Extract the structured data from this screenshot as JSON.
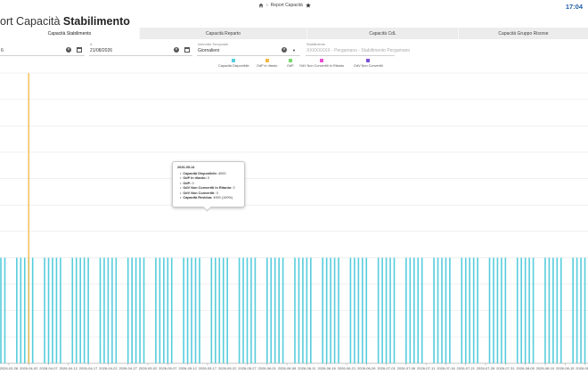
{
  "header": {
    "breadcrumb_separator": "›",
    "breadcrumb_current": "Report Capacità",
    "clock": "17:04"
  },
  "title": {
    "light": "ort Capacità",
    "bold": "Stabilimento"
  },
  "tabs": [
    {
      "label": "Capacità Stabilimento",
      "active": true
    },
    {
      "label": "Capacità Reparto",
      "active": false
    },
    {
      "label": "Capacità CdL",
      "active": false
    },
    {
      "label": "Capacità Gruppo Risorse",
      "active": false
    }
  ],
  "filters": {
    "from_value": "6",
    "to_label": "A",
    "to_value": "21/08/2026",
    "interval_label": "Intervallo Temporale",
    "interval_value": "Giornaliero",
    "plant_label": "Stabilimento",
    "plant_value": "XXXXXXXX - Pergamano - Stabilimento Pergamano"
  },
  "colors": {
    "capacity": "#56cddc",
    "odp_late": "#f5b940",
    "odp": "#77d96e",
    "odv_not_converted_late": "#e94fd2",
    "odv_not_converted": "#7b4fd9",
    "grid": "#e6e6e6",
    "axis": "#999999"
  },
  "chart_data": {
    "type": "bar",
    "legend": [
      "Capacità Disponibile",
      "OdP in ritardo",
      "OdP",
      "OdV Non Convertiti In Ritardo",
      "OdV Non Convertiti"
    ],
    "legend_position": "top-right",
    "grid": true,
    "series_name": "Capacità Disponibile",
    "bar_value": 4000,
    "ylim": [
      0,
      11000
    ],
    "x_start": "2026-03-26",
    "x_end": "2026-08-21",
    "weekends_excluded": true,
    "today_marker": "2026-04-02",
    "tick_labels": [
      "2026-03-28",
      "2026-04-02",
      "2026-04-07",
      "2026-04-12",
      "2026-04-17",
      "2026-04-22",
      "2026-04-27",
      "2026-05-02",
      "2026-05-07",
      "2026-05-12",
      "2026-05-17",
      "2026-05-22",
      "2026-05-27",
      "2026-06-01",
      "2026-06-06",
      "2026-06-11",
      "2026-06-16",
      "2026-06-21",
      "2026-06-26",
      "2026-07-01",
      "2026-07-06",
      "2026-07-11",
      "2026-07-16",
      "2026-07-21",
      "2026-07-26",
      "2026-07-31",
      "2026-08-05",
      "2026-08-10",
      "2026-08-15",
      "2026-08-20"
    ]
  },
  "tooltip": {
    "date": "2026-05-14",
    "rows": [
      {
        "label": "Capacità Disponibile:",
        "value": "4000"
      },
      {
        "label": "OdP In ritardo:",
        "value": "0"
      },
      {
        "label": "OdP:",
        "value": "0"
      },
      {
        "label": "OdV Non Convertiti In Ritardo:",
        "value": "0"
      },
      {
        "label": "OdV Non Convertiti:",
        "value": "0"
      },
      {
        "label": "Capacità Residua:",
        "value": "4000 (100%)"
      }
    ]
  }
}
